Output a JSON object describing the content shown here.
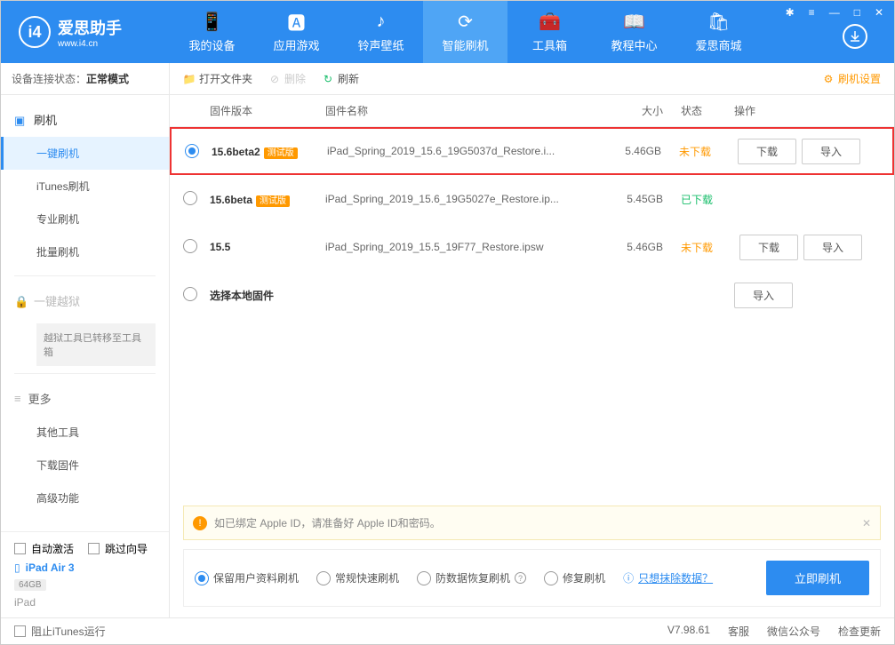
{
  "app": {
    "title": "爱思助手",
    "url": "www.i4.cn"
  },
  "nav": [
    {
      "label": "我的设备"
    },
    {
      "label": "应用游戏"
    },
    {
      "label": "铃声壁纸"
    },
    {
      "label": "智能刷机",
      "active": true
    },
    {
      "label": "工具箱"
    },
    {
      "label": "教程中心"
    },
    {
      "label": "爱思商城"
    }
  ],
  "status": {
    "label": "设备连接状态：",
    "value": "正常模式"
  },
  "sidebar": {
    "flash_title": "刷机",
    "items": [
      "一键刷机",
      "iTunes刷机",
      "专业刷机",
      "批量刷机"
    ],
    "jailbreak": "一键越狱",
    "jailbreak_note": "越狱工具已转移至工具箱",
    "more": "更多",
    "more_items": [
      "其他工具",
      "下载固件",
      "高级功能"
    ]
  },
  "device": {
    "auto_activate": "自动激活",
    "skip_guide": "跳过向导",
    "name": "iPad Air 3",
    "storage": "64GB",
    "type": "iPad"
  },
  "toolbar": {
    "open": "打开文件夹",
    "delete": "删除",
    "refresh": "刷新",
    "settings": "刷机设置"
  },
  "columns": {
    "version": "固件版本",
    "name": "固件名称",
    "size": "大小",
    "status": "状态",
    "action": "操作"
  },
  "rows": [
    {
      "version": "15.6beta2",
      "beta": "测试版",
      "name": "iPad_Spring_2019_15.6_19G5037d_Restore.i...",
      "size": "5.46GB",
      "status": "未下载",
      "status_cls": "not-downloaded",
      "selected": true,
      "show_actions": true,
      "highlight": true
    },
    {
      "version": "15.6beta",
      "beta": "测试版",
      "name": "iPad_Spring_2019_15.6_19G5027e_Restore.ip...",
      "size": "5.45GB",
      "status": "已下载",
      "status_cls": "downloaded",
      "selected": false,
      "show_actions": false
    },
    {
      "version": "15.5",
      "beta": "",
      "name": "iPad_Spring_2019_15.5_19F77_Restore.ipsw",
      "size": "5.46GB",
      "status": "未下载",
      "status_cls": "not-downloaded",
      "selected": false,
      "show_actions": true
    },
    {
      "version": "",
      "beta": "",
      "name_in_version": "选择本地固件",
      "name": "",
      "size": "",
      "status": "",
      "selected": false,
      "local": true
    }
  ],
  "buttons": {
    "download": "下载",
    "import": "导入"
  },
  "notice": "如已绑定 Apple ID，请准备好 Apple ID和密码。",
  "options": {
    "keep": "保留用户资料刷机",
    "normal": "常规快速刷机",
    "recover": "防数据恢复刷机",
    "repair": "修复刷机",
    "erase": "只想抹除数据？",
    "flash": "立即刷机"
  },
  "footer": {
    "block_itunes": "阻止iTunes运行",
    "version": "V7.98.61",
    "service": "客服",
    "wechat": "微信公众号",
    "update": "检查更新"
  }
}
